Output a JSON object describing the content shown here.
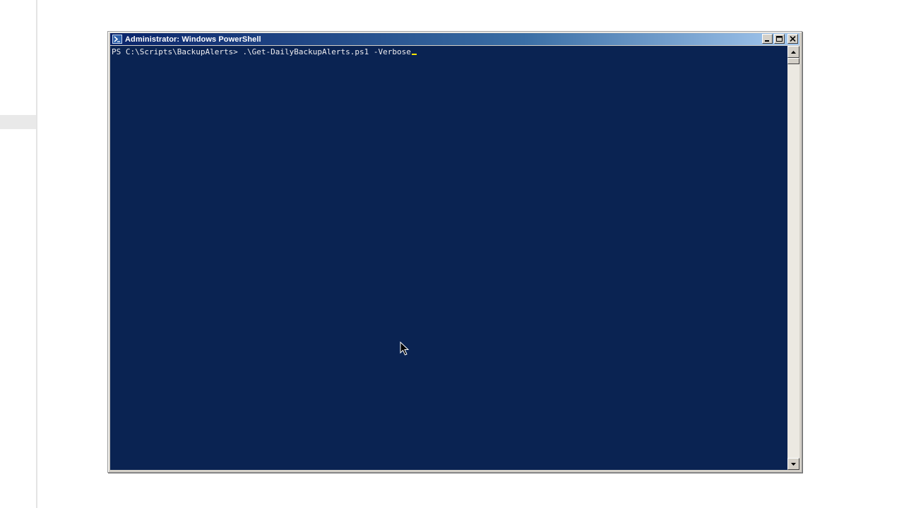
{
  "window": {
    "title": "Administrator: Windows PowerShell",
    "icon": "powershell-icon",
    "buttons": [
      "minimize-icon",
      "maximize-icon",
      "close-icon"
    ]
  },
  "console": {
    "prompt": "PS C:\\Scripts\\BackupAlerts> ",
    "command": ".\\Get-DailyBackupAlerts.ps1 -Verbose",
    "background_color": "#0a2352",
    "text_color": "#eeedf0",
    "cursor_color": "#ffe600"
  },
  "colors": {
    "titlebar_start": "#0a246a",
    "titlebar_end": "#a6caf0",
    "chrome": "#d4d0c8"
  }
}
